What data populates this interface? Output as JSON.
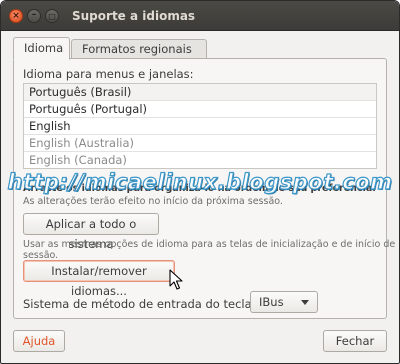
{
  "window": {
    "title": "Suporte a idiomas",
    "close_glyph": "×",
    "minimize_glyph": "–",
    "maximize_glyph": "□"
  },
  "tabs": [
    {
      "label": "Idioma",
      "active": true
    },
    {
      "label": "Formatos regionais",
      "active": false
    }
  ],
  "language_section": {
    "label": "Idioma para menus e janelas:",
    "items": [
      {
        "label": "Português (Brasil)",
        "dim": false
      },
      {
        "label": "Português (Portugal)",
        "dim": false
      },
      {
        "label": "English",
        "dim": false
      },
      {
        "label": "English (Australia)",
        "dim": true
      },
      {
        "label": "English (Canada)",
        "dim": true
      }
    ],
    "drag_hint": "Arraste os idiomas para organizá-lo na ordem de sua preferência.",
    "effect_hint": "As alterações terão efeito no início da próxima sessão."
  },
  "apply_button": "Aplicar a todo o sistema",
  "apply_hint": "Usar as mesmas opções de idioma para as telas de inicialização e de início de sessão.",
  "install_button": "Instalar/remover idiomas...",
  "input_method": {
    "label": "Sistema de método de entrada do teclado:",
    "value": "IBus"
  },
  "footer": {
    "help_button": "Ajuda",
    "close_button": "Fechar"
  },
  "watermark": "http://micaelinux.blogspot.com",
  "colors": {
    "accent": "#e0552a",
    "titlebar": "#3c3b37",
    "watermark": "#2e8fc5"
  }
}
